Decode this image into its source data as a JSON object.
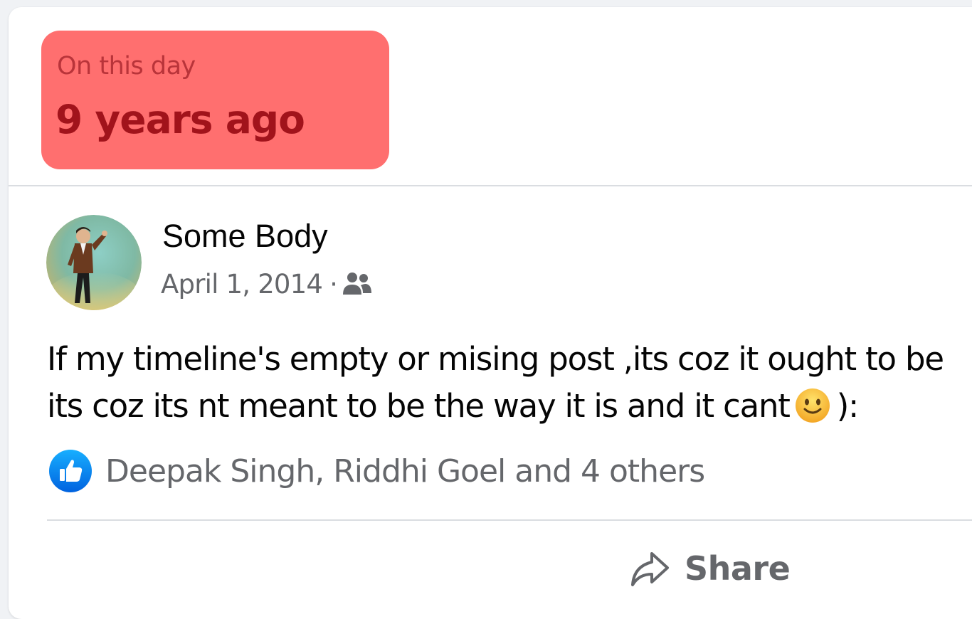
{
  "memory": {
    "eyebrow": "On this day",
    "title": "9 years ago",
    "badge_color": "#ff6f6f"
  },
  "post": {
    "author": "Some Body",
    "date": "April 1, 2014",
    "separator": "·",
    "audience_icon": "friends-icon",
    "text_line1": "If my timeline's empty or mising post ,its coz it ought to be",
    "text_line2_before": "its coz its nt meant to be the way it is and it cant",
    "emoji": "slightly-smiling-face-icon",
    "text_line2_after": "):"
  },
  "reactions": {
    "icon": "like-icon",
    "summary": "Deepak Singh, Riddhi Goel and 4 others",
    "like_color": "#1877f2"
  },
  "actions": {
    "share_label": "Share",
    "share_icon": "share-arrow-icon"
  }
}
